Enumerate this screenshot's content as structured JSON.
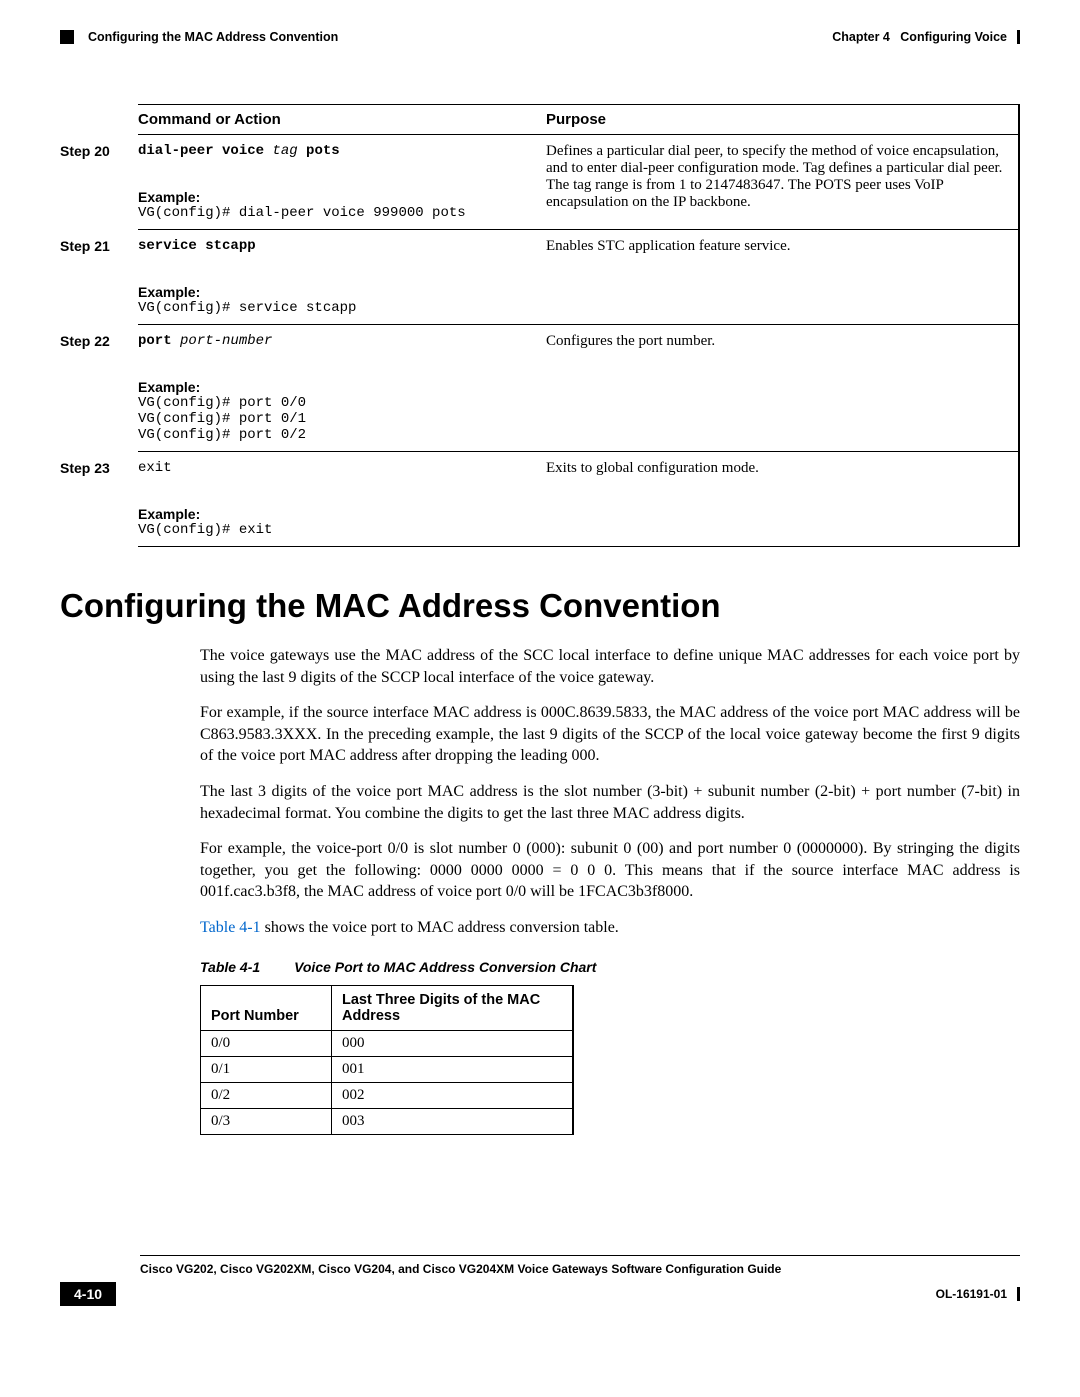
{
  "header": {
    "chapter_label": "Chapter 4",
    "chapter_title": "Configuring Voice",
    "section_title": "Configuring the MAC Address Convention"
  },
  "cmd_table": {
    "headers": {
      "command": "Command or Action",
      "purpose": "Purpose"
    },
    "rows": [
      {
        "step": "Step 20",
        "command_parts": {
          "pre": "dial-peer voice ",
          "arg": "tag",
          "post": " pots"
        },
        "example_label": "Example:",
        "example": "VG(config)# dial-peer voice 999000 pots",
        "purpose": "Defines a particular dial peer, to specify the method of voice encapsulation, and to enter dial-peer configuration mode. Tag defines a particular dial peer. The tag range is from 1 to 2147483647. The POTS peer uses VoIP encapsulation on the IP backbone."
      },
      {
        "step": "Step 21",
        "command_parts": {
          "pre": "service stcapp",
          "arg": "",
          "post": ""
        },
        "example_label": "Example:",
        "example": "VG(config)# service stcapp",
        "purpose": "Enables STC application feature service."
      },
      {
        "step": "Step 22",
        "command_parts": {
          "pre": "port ",
          "arg": "port-number",
          "post": ""
        },
        "example_label": "Example:",
        "example": "VG(config)# port 0/0\nVG(config)# port 0/1\nVG(config)# port 0/2",
        "purpose": "Configures the port number."
      },
      {
        "step": "Step 23",
        "command_parts": {
          "pre": "",
          "arg": "",
          "post": "exit"
        },
        "plain_command": "exit",
        "example_label": "Example:",
        "example": "VG(config)# exit",
        "purpose": "Exits to global configuration mode."
      }
    ]
  },
  "section": {
    "heading": "Configuring the MAC Address Convention",
    "paragraphs": [
      "The voice gateways use the MAC address of the SCC local interface to define unique MAC addresses for each voice port by using the last 9 digits of the SCCP local interface of the voice gateway.",
      "For example, if the source interface MAC address is 000C.8639.5833, the MAC address of the voice port MAC address will be C863.9583.3XXX. In the preceding example, the last 9 digits of the SCCP of the local voice gateway become the first 9 digits of the voice port MAC address after dropping the leading 000.",
      "The last 3 digits of the voice port MAC address is the slot number (3-bit) + subunit number (2-bit) + port number (7-bit) in hexadecimal format. You combine the digits to get the last three MAC address digits.",
      "For example, the voice-port 0/0 is slot number 0 (000): subunit 0 (00) and port number 0 (0000000). By stringing the digits together, you get the following: 0000 0000 0000 = 0 0 0. This means that if the source interface MAC address is 001f.cac3.b3f8, the MAC address of voice port 0/0 will be 1FCAC3b3f8000."
    ],
    "table_ref_link": "Table 4-1",
    "table_ref_rest": " shows the voice port to MAC address conversion table."
  },
  "conv_table": {
    "caption_num": "Table 4-1",
    "caption_title": "Voice Port to MAC Address Conversion Chart",
    "headers": {
      "port": "Port Number",
      "digits": "Last Three Digits of the MAC Address"
    },
    "rows": [
      {
        "port": "0/0",
        "digits": "000"
      },
      {
        "port": "0/1",
        "digits": "001"
      },
      {
        "port": "0/2",
        "digits": "002"
      },
      {
        "port": "0/3",
        "digits": "003"
      }
    ]
  },
  "footer": {
    "doc_title": "Cisco VG202, Cisco VG202XM, Cisco VG204, and Cisco VG204XM Voice Gateways Software Configuration Guide",
    "page_num": "4-10",
    "doc_id": "OL-16191-01"
  }
}
